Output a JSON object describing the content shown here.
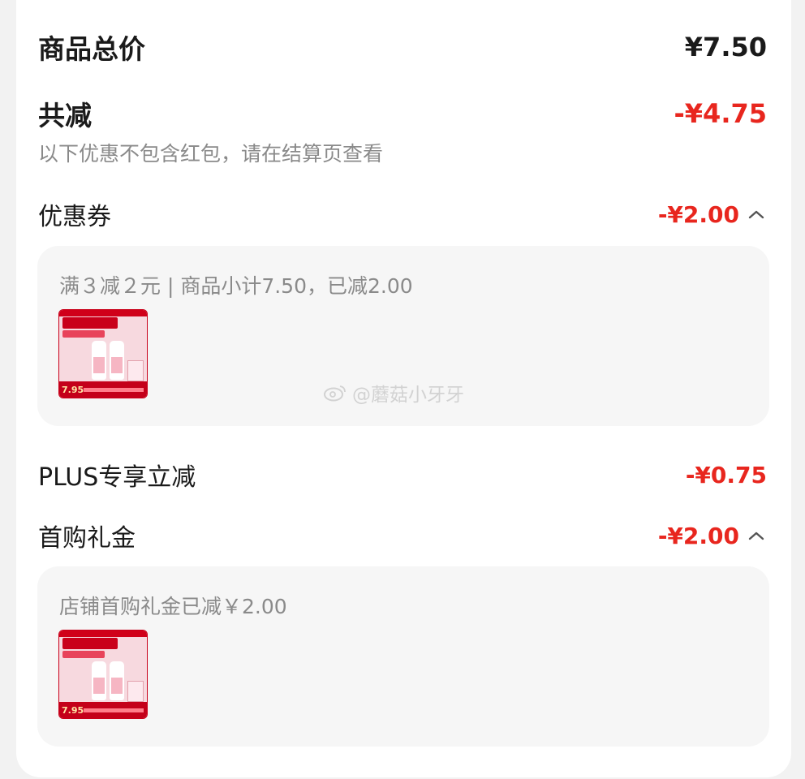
{
  "summary": {
    "total_label": "商品总价",
    "total_value": "¥7.50",
    "discount_label": "共减",
    "discount_value": "-¥4.75",
    "note": "以下优惠不包含红包，请在结算页查看"
  },
  "coupon": {
    "label": "优惠券",
    "value": "-¥2.00",
    "detail": "满３减２元 | 商品小计7.50，已减2.00",
    "product": {
      "price": "7.95"
    }
  },
  "plus": {
    "label": "PLUS专享立减",
    "value": "-¥0.75"
  },
  "first_purchase": {
    "label": "首购礼金",
    "value": "-¥2.00",
    "detail": "店铺首购礼金已减￥2.00",
    "product": {
      "price": "7.95"
    }
  },
  "watermark": {
    "text": "@蘑菇小牙牙"
  },
  "colors": {
    "accent_red": "#e8261e",
    "panel_bg": "#f6f6f6",
    "muted_text": "#8a8a8a"
  },
  "icons": {
    "expand": "chevron-up-icon",
    "watermark_logo": "weibo-icon"
  }
}
